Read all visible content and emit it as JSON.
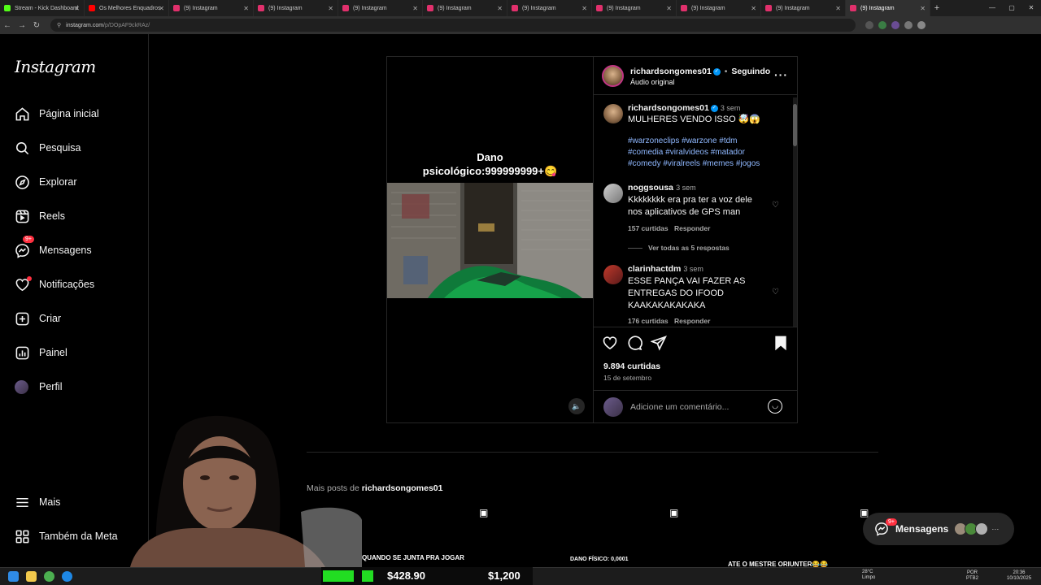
{
  "browser": {
    "tabs": [
      {
        "title": "Stream - Kick Dashboard",
        "color": "#53fc18",
        "active": false
      },
      {
        "title": "Os Melhores Enquadros",
        "color": "#ff0000",
        "active": false
      },
      {
        "title": "(9) Instagram",
        "color": "#e1306c",
        "active": false
      },
      {
        "title": "(9) Instagram",
        "color": "#e1306c",
        "active": false
      },
      {
        "title": "(9) Instagram",
        "color": "#e1306c",
        "active": false
      },
      {
        "title": "(9) Instagram",
        "color": "#e1306c",
        "active": false
      },
      {
        "title": "(9) Instagram",
        "color": "#e1306c",
        "active": false
      },
      {
        "title": "(9) Instagram",
        "color": "#e1306c",
        "active": false
      },
      {
        "title": "(9) Instagram",
        "color": "#e1306c",
        "active": false
      },
      {
        "title": "(9) Instagram",
        "color": "#e1306c",
        "active": false
      },
      {
        "title": "(9) Instagram",
        "color": "#e1306c",
        "active": true
      }
    ],
    "url_host": "instagram.com",
    "url_path": "/p/DOpAF9ckRAz/"
  },
  "sidebar": {
    "logo": "Instagram",
    "items": [
      {
        "label": "Página inicial",
        "icon": "home-icon"
      },
      {
        "label": "Pesquisa",
        "icon": "search-icon"
      },
      {
        "label": "Explorar",
        "icon": "compass-icon"
      },
      {
        "label": "Reels",
        "icon": "reels-icon"
      },
      {
        "label": "Mensagens",
        "icon": "messenger-icon",
        "badge": "9+"
      },
      {
        "label": "Notificações",
        "icon": "heart-icon"
      },
      {
        "label": "Criar",
        "icon": "plus-square-icon"
      },
      {
        "label": "Painel",
        "icon": "chart-icon"
      },
      {
        "label": "Perfil",
        "icon": "avatar"
      }
    ],
    "more": "Mais",
    "meta": "Também da Meta"
  },
  "post": {
    "media_caption_line1": "Dano",
    "media_caption_line2": "psicológico:999999999+😋",
    "header": {
      "username": "richardsongomes01",
      "following": "Seguindo",
      "audio": "Áudio original",
      "separator": "•"
    },
    "caption": {
      "username": "richardsongomes01",
      "time": "3 sem",
      "text": "MULHERES VENDO ISSO 🤯😱",
      "hashtags_1": "#warzoneclips #warzone #tdm",
      "hashtags_2": "#comedia #viralvideos #matador",
      "hashtags_3": "#comedy #viralreels #memes #jogos"
    },
    "comments": [
      {
        "username": "noggsousa",
        "time": "3 sem",
        "line1": "Kkkkkkkk era pra ter a voz dele",
        "line2": "nos aplicativos de GPS man",
        "likes": "157 curtidas",
        "reply": "Responder",
        "view_replies": "Ver todas as 5 respostas"
      },
      {
        "username": "clarinhactdm",
        "time": "3 sem",
        "line1": "ESSE PANÇA VAI FAZER AS",
        "line2": "ENTREGAS DO IFOOD",
        "line3": "KAAKAKAKAKAKA",
        "likes": "176 curtidas",
        "reply": "Responder"
      }
    ],
    "likes": "9.894 curtidas",
    "date": "15 de setembro",
    "comment_placeholder": "Adicione um comentário..."
  },
  "more_posts": {
    "prefix": "Mais posts de",
    "username": "richardsongomes01",
    "thumbs": [
      {
        "text": "QUANDO SE JUNTA PRA JOGAR"
      },
      {
        "text": "DANO FÍSICO: 0,0001"
      },
      {
        "text": "ATE O MESTRE ORIUNTER😂😂"
      }
    ]
  },
  "messages_pill": {
    "label": "Mensagens",
    "badge": "9+",
    "more": "···"
  },
  "stream_overlay": {
    "value1": "$428.90",
    "value2": "$1,200"
  },
  "taskbar": {
    "weather_temp": "28°C",
    "weather_text": "Limpo",
    "lang1": "POR",
    "lang2": "PTB2",
    "time": "20:36",
    "date": "10/10/2025"
  },
  "colors": {
    "accent": "#0095f6",
    "badge": "#ff3040",
    "hashtag": "#8fb8ff"
  }
}
